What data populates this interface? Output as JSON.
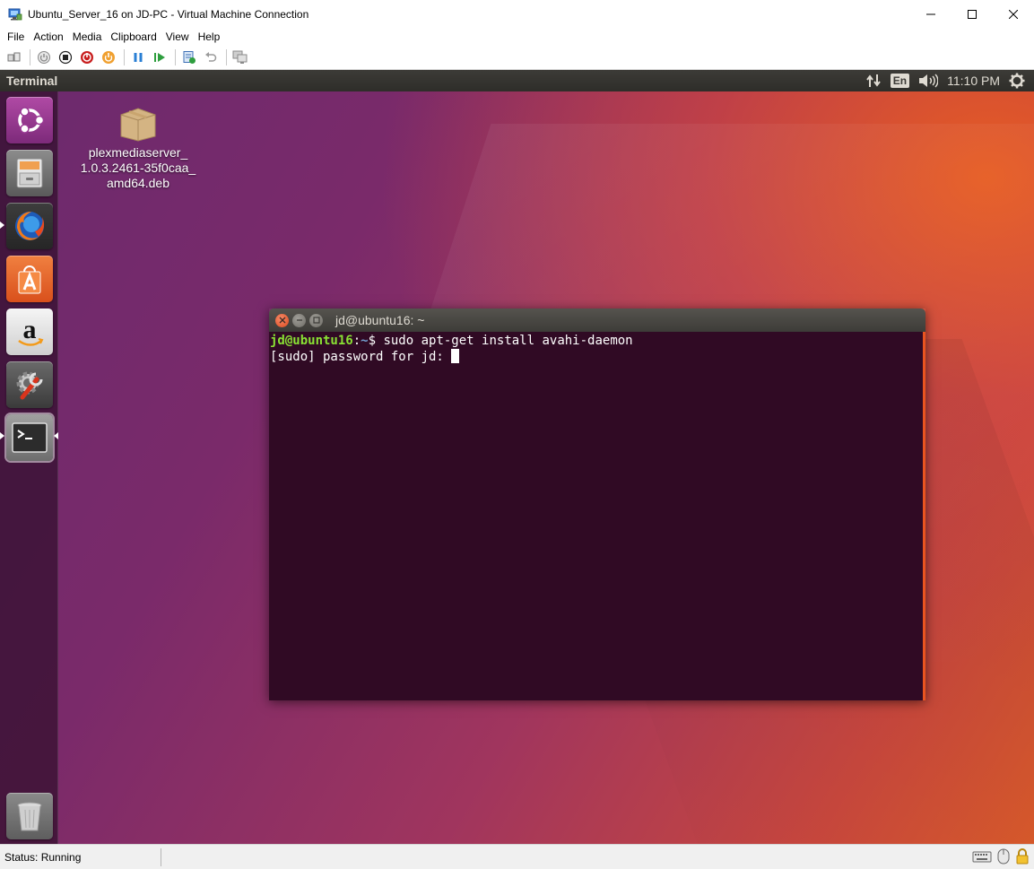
{
  "window": {
    "title": "Ubuntu_Server_16 on JD-PC - Virtual Machine Connection",
    "controls": {
      "minimize": "—",
      "maximize": "☐",
      "close": "✕"
    }
  },
  "menu": {
    "items": [
      {
        "label": "File"
      },
      {
        "label": "Action"
      },
      {
        "label": "Media"
      },
      {
        "label": "Clipboard"
      },
      {
        "label": "View"
      },
      {
        "label": "Help"
      }
    ]
  },
  "toolbar": {
    "buttons": [
      {
        "name": "ctrl-alt-del-icon"
      },
      {
        "name": "start-icon"
      },
      {
        "name": "turn-off-icon"
      },
      {
        "name": "shutdown-icon"
      },
      {
        "name": "save-icon"
      },
      {
        "name": "pause-icon"
      },
      {
        "name": "reset-icon"
      },
      {
        "name": "checkpoint-icon"
      },
      {
        "name": "revert-icon"
      },
      {
        "name": "enhanced-session-icon"
      }
    ]
  },
  "guest": {
    "topbar": {
      "app_title": "Terminal",
      "keyboard_layout": "En",
      "clock": "11:10 PM"
    },
    "launcher": {
      "items": [
        {
          "name": "ubuntu-dash"
        },
        {
          "name": "files"
        },
        {
          "name": "firefox"
        },
        {
          "name": "ubuntu-software"
        },
        {
          "name": "amazon"
        },
        {
          "name": "system-settings"
        },
        {
          "name": "terminal"
        },
        {
          "name": "trash"
        }
      ]
    },
    "desktop_file": {
      "line1": "plexmediaserver_",
      "line2": "1.0.3.2461-35f0caa_",
      "line3": "amd64.deb"
    },
    "terminal": {
      "title": "jd@ubuntu16: ~",
      "prompt_user": "jd@ubuntu16",
      "prompt_colon": ":",
      "prompt_path": "~",
      "prompt_symbol": "$ ",
      "command": "sudo apt-get install avahi-daemon",
      "line2": "[sudo] password for jd: "
    },
    "colors": {
      "terminal_bg": "#300a24",
      "accent": "#e95420",
      "prompt_user": "#8ae234",
      "prompt_path": "#729fcf"
    }
  },
  "status": {
    "text": "Status: Running"
  }
}
